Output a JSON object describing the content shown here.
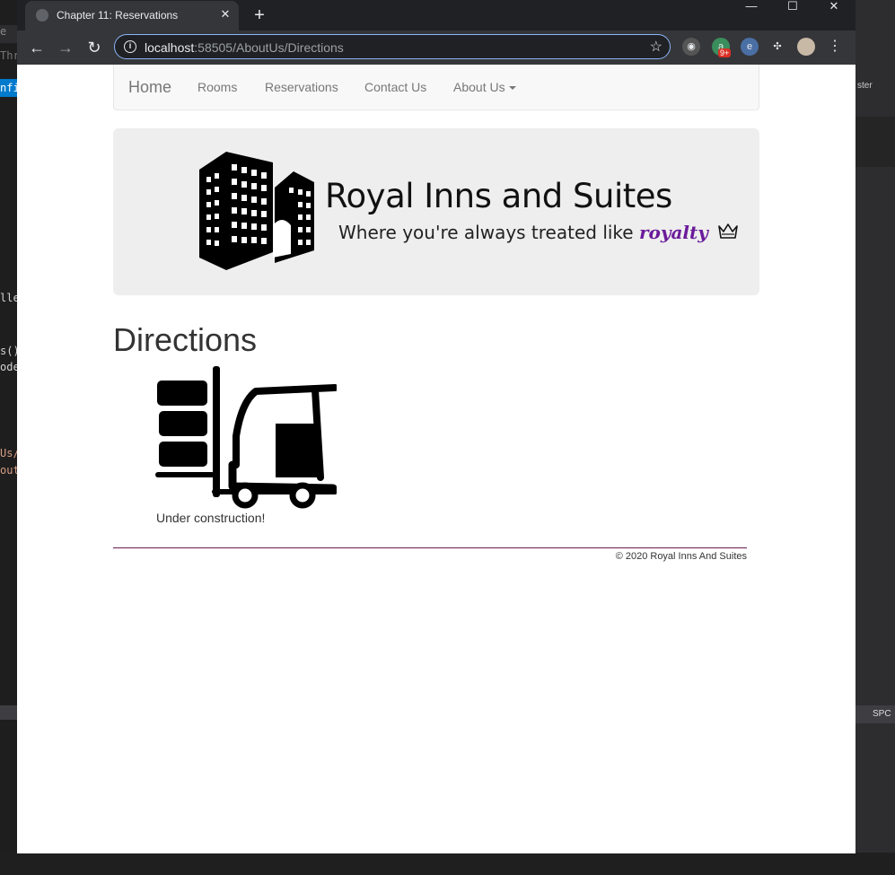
{
  "browser": {
    "tab_title": "Chapter 11: Reservations",
    "url_host": "localhost",
    "url_rest": ":58505/AboutUs/Directions",
    "extension_badge": "9+"
  },
  "navbar": {
    "brand": "Home",
    "links": [
      "Rooms",
      "Reservations",
      "Contact Us",
      "About Us"
    ]
  },
  "banner": {
    "title": "Royal Inns and Suites",
    "tagline_prefix": "Where you're always treated like ",
    "tagline_emphasis": "royalty"
  },
  "main": {
    "heading": "Directions",
    "message": "Under construction!"
  },
  "footer": {
    "copyright": "© 2020 Royal Inns And Suites"
  },
  "background_ide": {
    "code_fragments": [
      "lle",
      "s()",
      "ode",
      "Us/",
      "out"
    ],
    "left_labels": [
      "e",
      "Thre",
      "nfig"
    ],
    "right_labels": [
      "ster",
      "SPC"
    ]
  },
  "colors": {
    "accent": "#6a1b9a",
    "footer_rule": "#6a1b4d",
    "jumbotron": "#eeeeee",
    "navbar": "#f8f8f8"
  },
  "icons": [
    "globe-icon",
    "close-icon",
    "plus-icon",
    "back-icon",
    "forward-icon",
    "reload-icon",
    "info-icon",
    "star-icon",
    "puzzle-icon",
    "avatar",
    "menu-icon",
    "hotel-building-icon",
    "crown-icon",
    "forklift-icon"
  ]
}
